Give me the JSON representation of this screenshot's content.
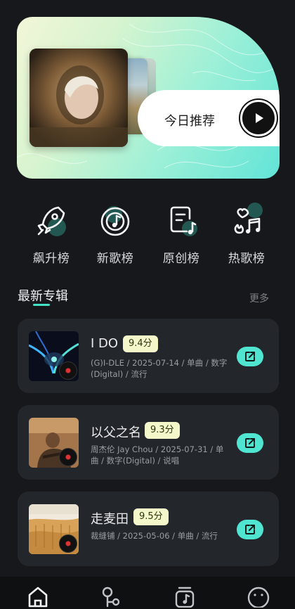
{
  "hero": {
    "today_label": "今日推荐",
    "accent": "#50e5d0"
  },
  "categories": [
    {
      "label": "飙升榜",
      "icon": "rocket-icon"
    },
    {
      "label": "新歌榜",
      "icon": "music-disc-icon"
    },
    {
      "label": "原创榜",
      "icon": "music-note-doc-icon"
    },
    {
      "label": "热歌榜",
      "icon": "hot-music-icon"
    }
  ],
  "section": {
    "title": "最新专辑",
    "more": "更多"
  },
  "albums": [
    {
      "title": "I DO",
      "score": "9.4分",
      "meta": "(G)I-DLE / 2025-07-14 / 单曲 / 数字(Digital) / 流行"
    },
    {
      "title": "以父之名",
      "score": "9.3分",
      "meta": "周杰伦 Jay Chou / 2025-07-31 / 单曲 / 数字(Digital) / 说唱"
    },
    {
      "title": "走麦田",
      "score": "9.5分",
      "meta": "裁缝铺 / 2025-05-06 / 单曲 / 流行"
    }
  ],
  "nav": [
    {
      "icon": "home-icon"
    },
    {
      "icon": "discover-icon"
    },
    {
      "icon": "music-library-icon"
    },
    {
      "icon": "profile-icon"
    }
  ]
}
